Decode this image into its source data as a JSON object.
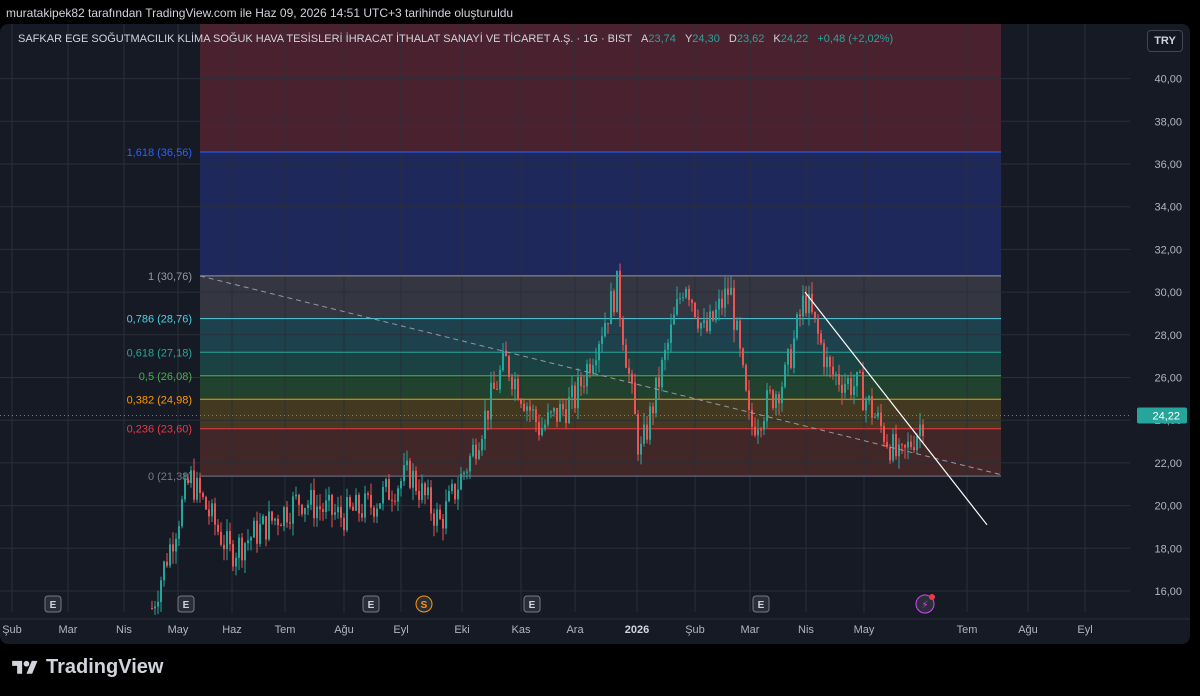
{
  "caption": "muratakipek82 tarafından TradingView.com ile Haz 09, 2026 14:51 UTC+3 tarihinde oluşturuldu",
  "symbol": {
    "name": "SAFKAR EGE SOĞUTMACILIK KLİMA SOĞUK HAVA TESİSLERİ İHRACAT İTHALAT SANAYİ VE TİCARET A.Ş. · 1G · BIST",
    "open_label": "A",
    "open": "23,74",
    "high_label": "Y",
    "high": "24,30",
    "low_label": "D",
    "low": "23,62",
    "close_label": "K",
    "close": "24,22",
    "change": "+0,48 (+2,02%)"
  },
  "currency": "TRY",
  "brand": "TradingView",
  "colors": {
    "up": "#26a69a",
    "down": "#ef5350",
    "background": "#161a25",
    "ext_zone": "#5b2433",
    "blue_zone": "#1f2a60"
  },
  "chart_data": {
    "type": "candlestick",
    "ylim": [
      15,
      42.5
    ],
    "price_ticks": [
      "16,00",
      "18,00",
      "20,00",
      "22,00",
      "24,00",
      "26,00",
      "28,00",
      "30,00",
      "32,00",
      "34,00",
      "36,00",
      "38,00",
      "40,00"
    ],
    "price_tick_values": [
      16,
      18,
      20,
      22,
      24,
      26,
      28,
      30,
      32,
      34,
      36,
      38,
      40
    ],
    "current_price_label": "24,22",
    "current_price": 24.22,
    "time_labels": [
      {
        "text": "Şub",
        "bold": false
      },
      {
        "text": "Mar",
        "bold": false
      },
      {
        "text": "Nis",
        "bold": false
      },
      {
        "text": "May",
        "bold": false
      },
      {
        "text": "Haz",
        "bold": false
      },
      {
        "text": "Tem",
        "bold": false
      },
      {
        "text": "Ağu",
        "bold": false
      },
      {
        "text": "Eyl",
        "bold": false
      },
      {
        "text": "Eki",
        "bold": false
      },
      {
        "text": "Kas",
        "bold": false
      },
      {
        "text": "Ara",
        "bold": false
      },
      {
        "text": "2026",
        "bold": true
      },
      {
        "text": "Şub",
        "bold": false
      },
      {
        "text": "Mar",
        "bold": false
      },
      {
        "text": "Nis",
        "bold": false
      },
      {
        "text": "May",
        "bold": false
      },
      {
        "text": "Tem",
        "bold": false
      },
      {
        "text": "Ağu",
        "bold": false
      },
      {
        "text": "Eyl",
        "bold": false
      }
    ],
    "fib_levels": [
      {
        "ratio": 1.618,
        "label": "1,618 (36,56)",
        "price": 36.56,
        "color": "#2962ff"
      },
      {
        "ratio": 1,
        "label": "1 (30,76)",
        "price": 30.76,
        "color": "#9598a1"
      },
      {
        "ratio": 0.786,
        "label": "0,786 (28,76)",
        "price": 28.76,
        "color": "#4dd0e1"
      },
      {
        "ratio": 0.618,
        "label": "0,618 (27,18)",
        "price": 27.18,
        "color": "#26a69a"
      },
      {
        "ratio": 0.5,
        "label": "0,5 (26,08)",
        "price": 26.08,
        "color": "#4caf50"
      },
      {
        "ratio": 0.382,
        "label": "0,382 (24,98)",
        "price": 24.98,
        "color": "#ff9800"
      },
      {
        "ratio": 0.236,
        "label": "0,236 (23,60)",
        "price": 23.6,
        "color": "#f23645"
      },
      {
        "ratio": 0,
        "label": "0 (21,38)",
        "price": 21.38,
        "color": "#787b86"
      }
    ],
    "event_markers": [
      "E",
      "E",
      "E",
      "S",
      "E",
      "E",
      "⚡"
    ],
    "key_points": [
      {
        "date": "2025-04",
        "price": 15.2
      },
      {
        "date": "2025-05",
        "price": 21.3
      },
      {
        "date": "2025-06",
        "price": 17.8
      },
      {
        "date": "2025-07",
        "price": 20.3
      },
      {
        "date": "2025-08",
        "price": 19.5
      },
      {
        "date": "2025-09",
        "price": 20.0
      },
      {
        "date": "2025-10",
        "price": 21.5
      },
      {
        "date": "2025-10-20",
        "price": 19.2
      },
      {
        "date": "2025-11-05",
        "price": 22.2
      },
      {
        "date": "2025-11-15",
        "price": 26.8
      },
      {
        "date": "2025-12-05",
        "price": 23.6
      },
      {
        "date": "2025-12-20",
        "price": 25.0
      },
      {
        "date": "2026-01-01",
        "price": 30.2
      },
      {
        "date": "2026-01-10",
        "price": 22.3
      },
      {
        "date": "2026-02-01",
        "price": 30.7
      },
      {
        "date": "2026-02-15",
        "price": 28.0
      },
      {
        "date": "2026-03-01",
        "price": 30.2
      },
      {
        "date": "2026-03-15",
        "price": 23.6
      },
      {
        "date": "2026-04-01",
        "price": 26.0
      },
      {
        "date": "2026-04-05",
        "price": 29.8
      },
      {
        "date": "2026-04-20",
        "price": 26.2
      },
      {
        "date": "2026-05-10",
        "price": 25.5
      },
      {
        "date": "2026-05-20",
        "price": 22.0
      },
      {
        "date": "2026-06-09",
        "price": 24.22
      }
    ]
  }
}
